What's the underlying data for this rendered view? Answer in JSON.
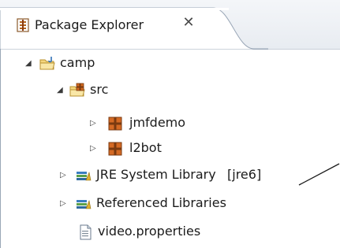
{
  "tab": {
    "title": "Package Explorer",
    "close_glyph": "✕",
    "icon": "package-explorer-icon"
  },
  "tree": {
    "project": {
      "label": "camp",
      "icon": "java-project-folder-icon",
      "expanded": true
    },
    "src": {
      "label": "src",
      "icon": "source-folder-icon",
      "expanded": true
    },
    "packages": [
      {
        "label": "jmfdemo",
        "icon": "package-icon",
        "expanded": false
      },
      {
        "label": "l2bot",
        "icon": "package-icon",
        "expanded": false
      }
    ],
    "jre": {
      "label": "JRE System Library",
      "decoration": "[jre6]",
      "icon": "library-icon",
      "expanded": false
    },
    "referenced": {
      "label": "Referenced Libraries",
      "icon": "library-icon",
      "expanded": false
    },
    "file": {
      "label": "video.properties",
      "icon": "properties-file-icon"
    }
  }
}
